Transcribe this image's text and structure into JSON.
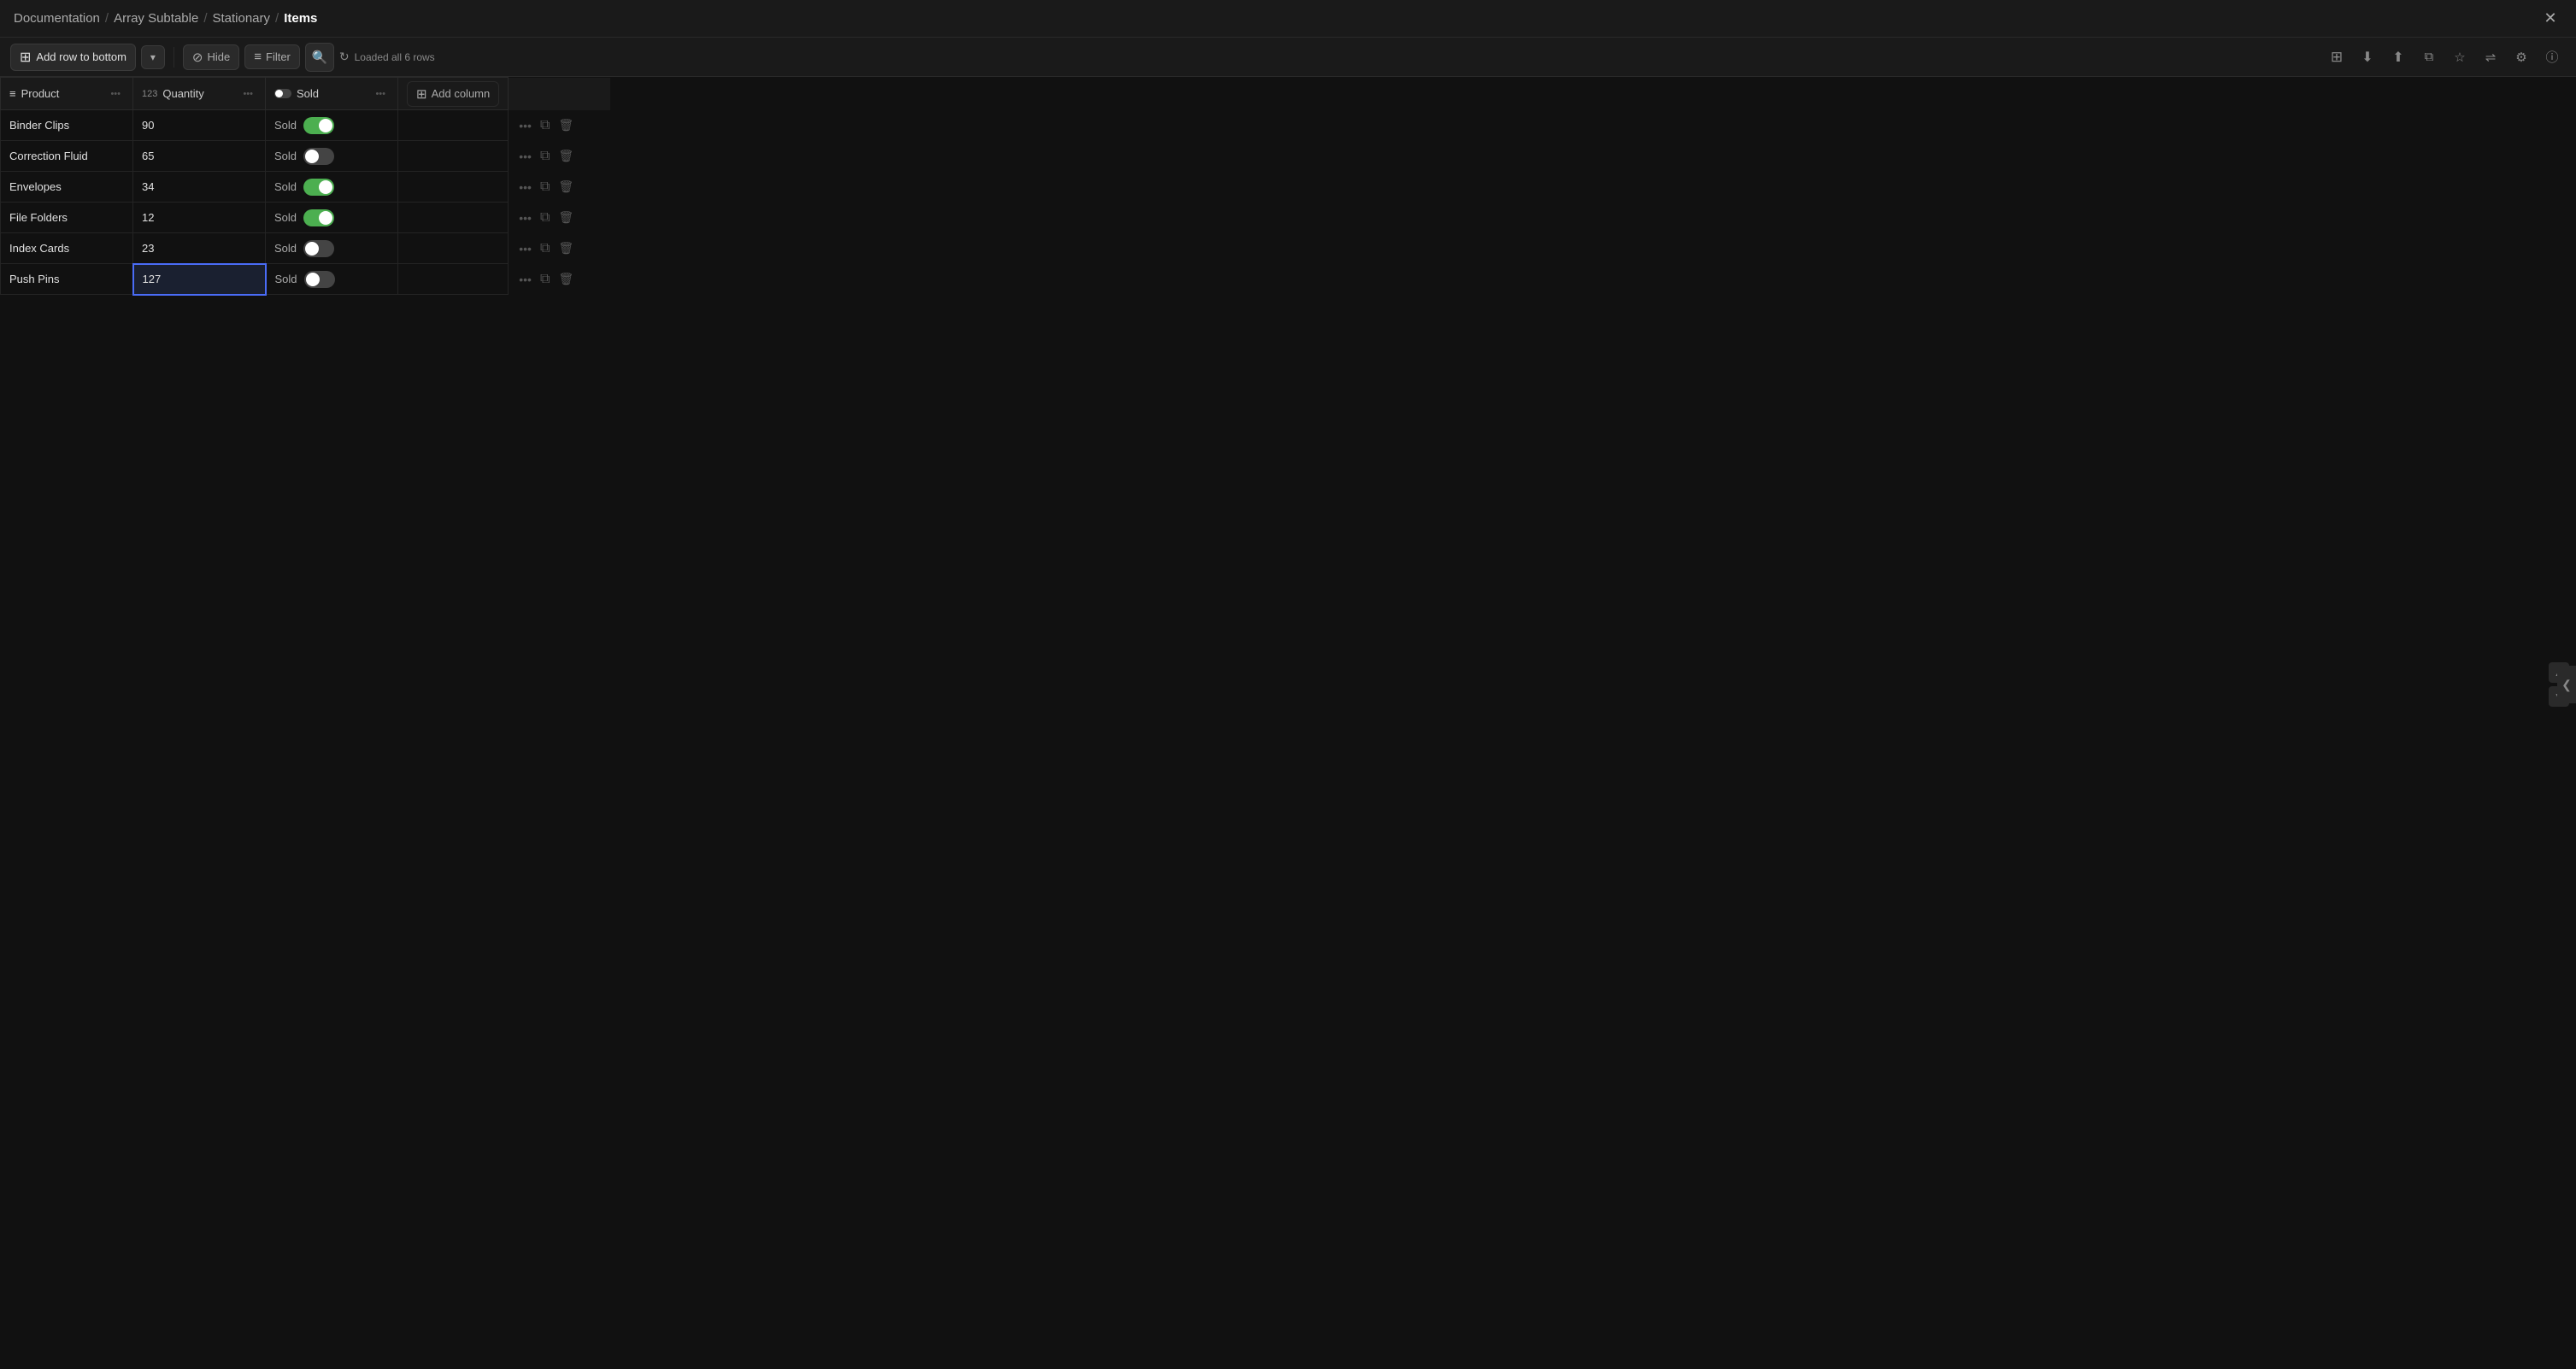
{
  "breadcrumb": {
    "items": [
      "Documentation",
      "Array Subtable",
      "Stationary",
      "Items"
    ],
    "separators": [
      "/",
      "/",
      "/"
    ]
  },
  "toolbar": {
    "add_row_label": "Add row to bottom",
    "hide_label": "Hide",
    "filter_label": "Filter",
    "status_label": "Loaded all 6 rows",
    "add_column_label": "Add column"
  },
  "columns": [
    {
      "id": "product",
      "icon": "≡",
      "type_icon": "",
      "label": "Product"
    },
    {
      "id": "quantity",
      "icon": "123",
      "type_icon": "",
      "label": "Quantity"
    },
    {
      "id": "sold",
      "icon": "",
      "type_icon": "",
      "label": "Sold"
    }
  ],
  "rows": [
    {
      "id": 1,
      "product": "Binder Clips",
      "quantity": "90",
      "sold": "Sold",
      "sold_status": true
    },
    {
      "id": 2,
      "product": "Correction Fluid",
      "quantity": "65",
      "sold": "Sold",
      "sold_status": false
    },
    {
      "id": 3,
      "product": "Envelopes",
      "quantity": "34",
      "sold": "Sold",
      "sold_status": true
    },
    {
      "id": 4,
      "product": "File Folders",
      "quantity": "12",
      "sold": "Sold",
      "sold_status": true
    },
    {
      "id": 5,
      "product": "Index Cards",
      "quantity": "23",
      "sold": "Sold",
      "sold_status": false
    },
    {
      "id": 6,
      "product": "Push Pins",
      "quantity": "127",
      "sold": "Sold",
      "sold_status": false,
      "editing_quantity": true
    }
  ],
  "icons": {
    "close": "✕",
    "add": "+",
    "chevron_down": "▾",
    "hide": "◌",
    "filter": "≡",
    "search": "🔍",
    "sync": "↻",
    "grid": "⊞",
    "download": "↓",
    "share": "↑",
    "star": "☆",
    "compare": "⇌",
    "settings": "⚙",
    "info": "ⓘ",
    "more": "•••",
    "copy": "⧉",
    "trash": "🗑",
    "scroll_up": "▲",
    "scroll_down": "▼",
    "collapse": "❮"
  },
  "colors": {
    "toggle_on": "#4caf50",
    "toggle_off": "#444444",
    "accent": "#4a6cf7",
    "bg": "#111111",
    "header_bg": "#1a1a1a",
    "border": "#2a2a2a"
  }
}
